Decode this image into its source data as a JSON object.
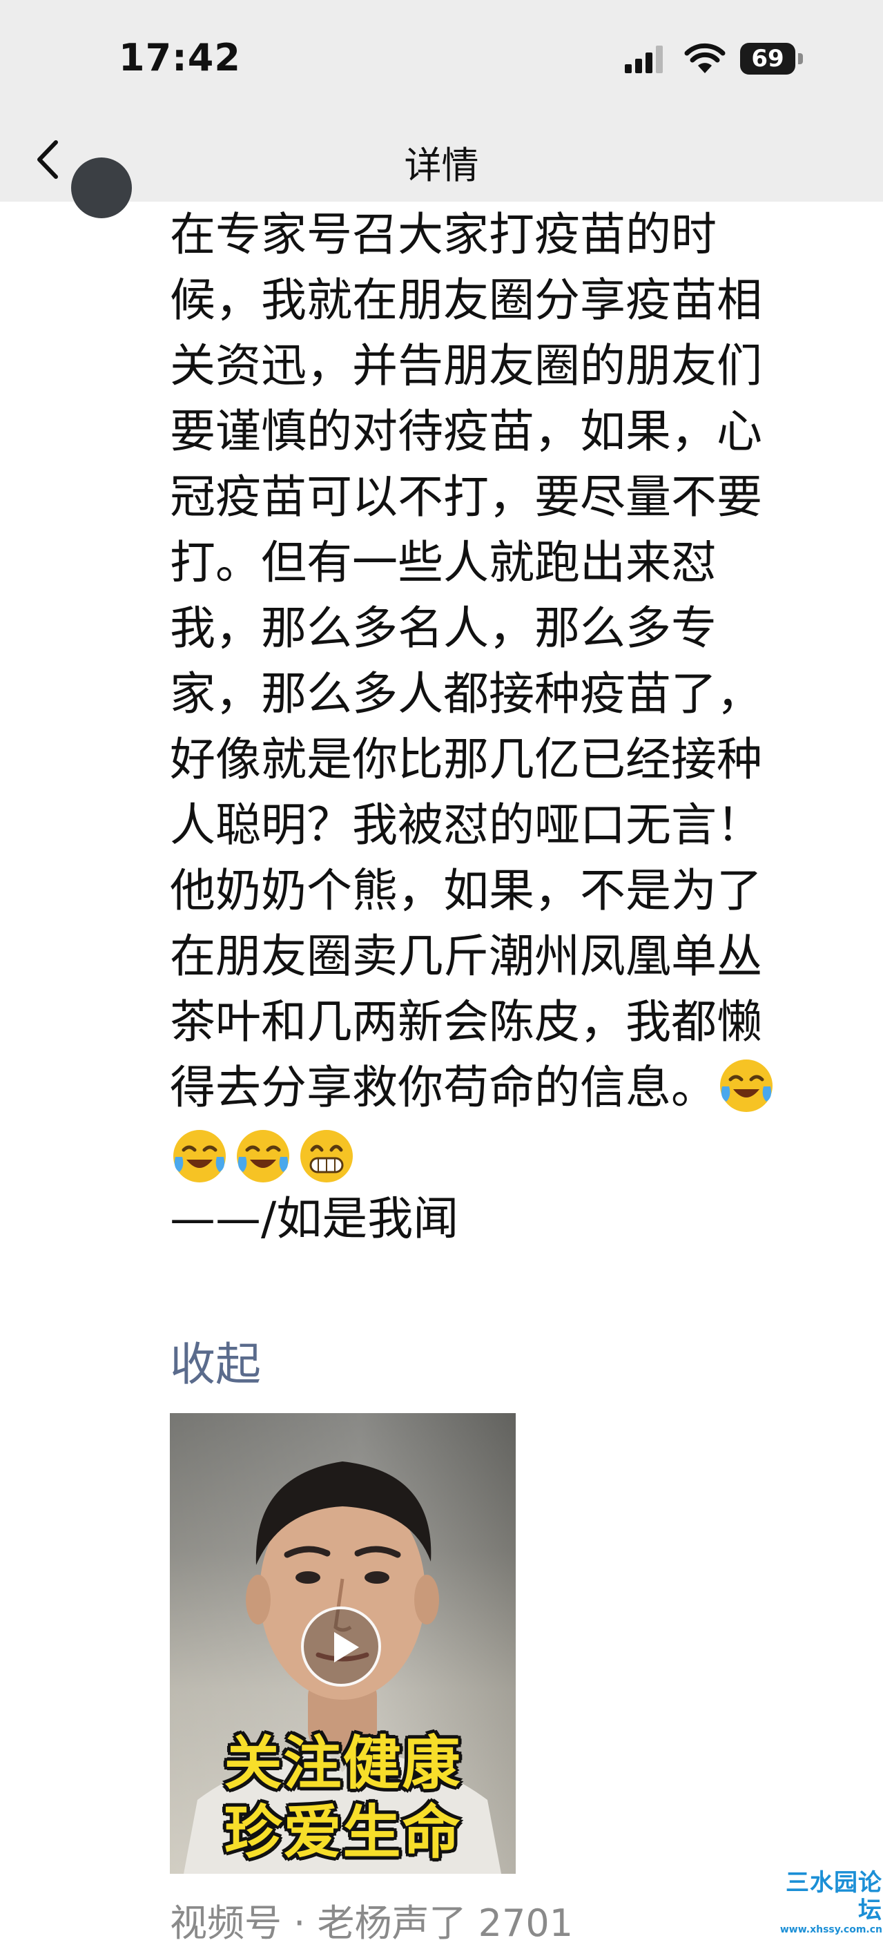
{
  "status_bar": {
    "time": "17:42",
    "battery_percent": "69",
    "icons": [
      "signal-icon",
      "wifi-icon",
      "battery-icon"
    ]
  },
  "nav": {
    "title": "详情",
    "back_icon": "chevron-left-icon"
  },
  "post": {
    "lines": [
      "在专家号召大家打疫苗的时",
      "候，我就在朋友圈分享疫苗相",
      "关资迅，并告朋友圈的朋友们",
      "要谨慎的对待疫苗，如果，心",
      "冠疫苗可以不打，要尽量不要",
      "打。但有一些人就跑出来怼",
      "我，那么多名人，那么多专",
      "家，那么多人都接种疫苗了，",
      "好像就是你比那几亿已经接种",
      "人聪明？我被怼的哑口无言！",
      "他奶奶个熊，如果，不是为了",
      "在朋友圈卖几斤潮州凤凰单丛",
      "茶叶和几两新会陈皮，我都懒",
      "得去分享救你苟命的信息。"
    ],
    "emojis_inline": [
      "crying-laughing-emoji"
    ],
    "emojis_line": [
      "crying-laughing-emoji",
      "crying-laughing-emoji",
      "grinning-emoji"
    ],
    "signature": "——/如是我闻",
    "collapse_label": "收起"
  },
  "video": {
    "caption_line1": "关注健康",
    "caption_line2": "珍爱生命",
    "play_icon": "play-icon"
  },
  "video_source_partial": "视频号 · 老杨声了 2701",
  "watermark": {
    "name": "三水园论坛",
    "url": "www.xhssy.com.cn"
  },
  "colors": {
    "bar_background": "#ededed",
    "link": "#5a6b8c",
    "caption": "#f7de2a",
    "watermark": "#1b8fd6"
  }
}
